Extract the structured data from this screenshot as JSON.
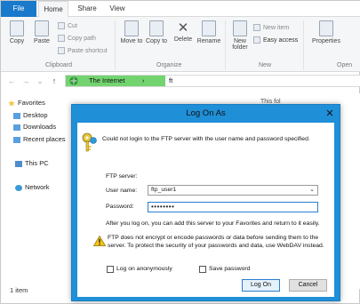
{
  "explorer": {
    "tabs": [
      "File",
      "Home",
      "Share",
      "View"
    ],
    "ribbon": {
      "copy": "Copy",
      "paste": "Paste",
      "cut": "Cut",
      "copy_path": "Copy path",
      "paste_shortcut": "Paste shortcut",
      "move_to": "Move to",
      "copy_to": "Copy to",
      "delete": "Delete",
      "rename": "Rename",
      "new_folder": "New folder",
      "new_item": "New item",
      "easy_access": "Easy access",
      "properties": "Properties",
      "groups": [
        "Clipboard",
        "Organize",
        "New",
        "Open"
      ]
    },
    "address": {
      "back": "←",
      "forward": "→",
      "recent": "⌄",
      "up": "↑",
      "segment_1": "The Internet",
      "chevron": "›",
      "segment_2": "ft"
    },
    "content_header": "This fol",
    "nav": {
      "favorites": "Favorites",
      "desktop": "Desktop",
      "downloads": "Downloads",
      "recent_places": "Recent places",
      "this_pc": "This PC",
      "network": "Network"
    },
    "status": "1 item"
  },
  "dialog": {
    "title": "Log On As",
    "close": "✕",
    "message": "Could not login to the FTP server with the user name and password specified.",
    "ftp_server_label": "FTP server:",
    "user_name_label": "User name:",
    "user_name_value": "ftp_user1",
    "password_label": "Password:",
    "password_value": "••••••••",
    "after_logon_text": "After you log on, you can add this server to your Favorites and return to it easily.",
    "warning_text": "FTP does not encrypt or encode passwords or data before sending them to the server.  To protect the security of your passwords and data, use WebDAV instead.",
    "log_on_anonymously": "Log on anonymously",
    "save_password": "Save password",
    "log_on_button": "Log On",
    "cancel_button": "Cancel"
  },
  "colors": {
    "dialog_frame": "#1f8fd8",
    "file_tab": "#1979ca",
    "address_highlight": "#72d36f"
  }
}
